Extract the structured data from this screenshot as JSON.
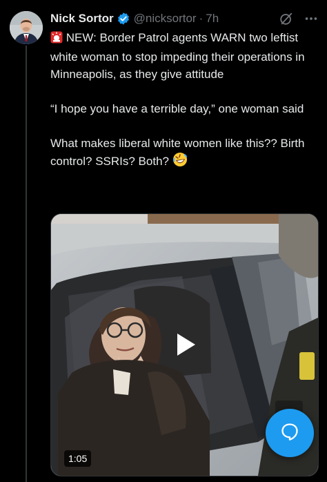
{
  "post": {
    "author_name": "Nick Sortor",
    "handle": "@nicksortor",
    "separator": "·",
    "time": "7h",
    "text_paragraphs": [
      "NEW: Border Patrol agents WARN two leftist white woman to stop impeding their operations in Minneapolis, as they give attitude",
      "“I hope you have a terrible day,” one woman said",
      "What makes liberal white women like this?? Birth control? SSRIs? Both?"
    ],
    "leading_emoji": "siren-emoji",
    "trailing_emoji": "rolling-laughing-emoji",
    "media": {
      "type": "video",
      "duration": "1:05"
    }
  },
  "colors": {
    "background": "#000000",
    "text": "#e7e9ea",
    "secondary_text": "#71767b",
    "accent": "#1d9bf0",
    "verified": "#1d9bf0"
  },
  "icons": {
    "verified": "verified-badge-icon",
    "grok": "grok-icon",
    "more": "more-options-icon",
    "play": "play-icon",
    "compose_reply": "chat-bubble-icon"
  }
}
